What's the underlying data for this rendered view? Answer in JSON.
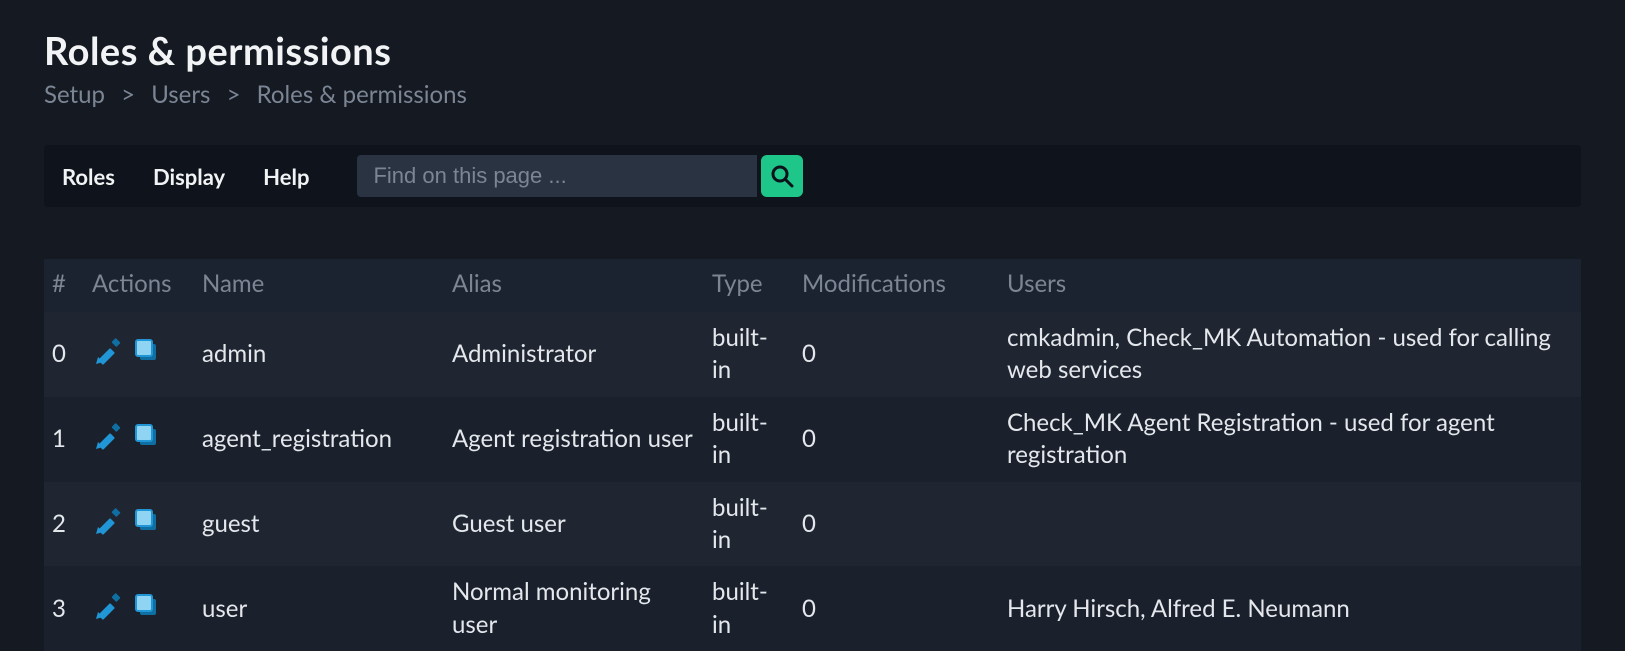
{
  "header": {
    "title": "Roles & permissions",
    "breadcrumb": [
      "Setup",
      "Users",
      "Roles & permissions"
    ]
  },
  "toolbar": {
    "menu": {
      "roles": "Roles",
      "display": "Display",
      "help": "Help"
    },
    "search_placeholder": "Find on this page ..."
  },
  "table": {
    "columns": {
      "index": "#",
      "actions": "Actions",
      "name": "Name",
      "alias": "Alias",
      "type": "Type",
      "modifications": "Modifications",
      "users": "Users"
    },
    "rows": [
      {
        "index": "0",
        "name": "admin",
        "alias": "Administrator",
        "type": "built-in",
        "modifications": "0",
        "users": "cmkadmin, Check_MK Automation - used for calling web services"
      },
      {
        "index": "1",
        "name": "agent_registration",
        "alias": "Agent registration user",
        "type": "built-in",
        "modifications": "0",
        "users": "Check_MK Agent Registration - used for agent registration"
      },
      {
        "index": "2",
        "name": "guest",
        "alias": "Guest user",
        "type": "built-in",
        "modifications": "0",
        "users": ""
      },
      {
        "index": "3",
        "name": "user",
        "alias": "Normal monitoring user",
        "type": "built-in",
        "modifications": "0",
        "users": "Harry Hirsch, Alfred E. Neumann"
      }
    ]
  }
}
